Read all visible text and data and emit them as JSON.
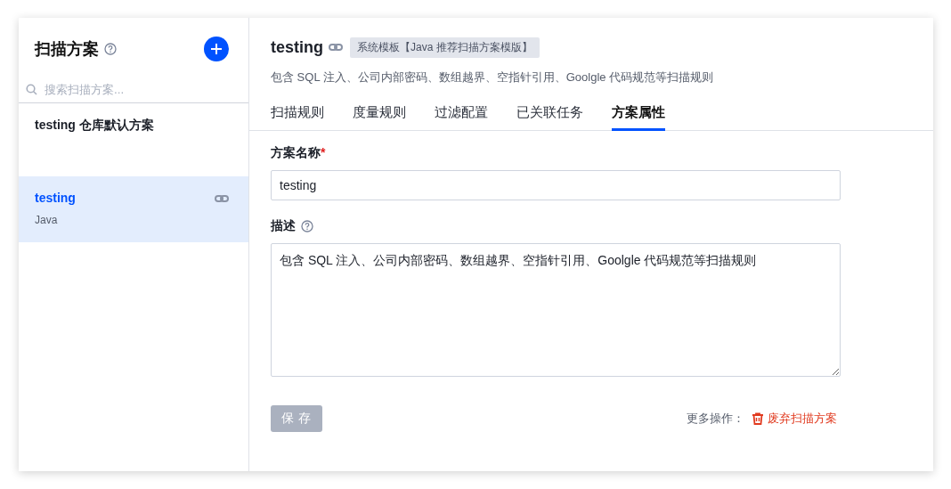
{
  "sidebar": {
    "title": "扫描方案",
    "search": {
      "placeholder": "搜索扫描方案..."
    },
    "items": [
      {
        "name": "testing 仓库默认方案",
        "selected": false,
        "linked": false
      },
      {
        "name": "testing",
        "subtitle": "Java",
        "selected": true,
        "linked": true
      }
    ]
  },
  "header": {
    "title": "testing",
    "tag": "系统模板【Java 推荐扫描方案模版】",
    "description": "包含 SQL 注入、公司内部密码、数组越界、空指针引用、Goolgle 代码规范等扫描规则"
  },
  "tabs": [
    {
      "label": "扫描规则",
      "selected": false
    },
    {
      "label": "度量规则",
      "selected": false
    },
    {
      "label": "过滤配置",
      "selected": false
    },
    {
      "label": "已关联任务",
      "selected": false
    },
    {
      "label": "方案属性",
      "selected": true
    }
  ],
  "form": {
    "name_label": "方案名称",
    "name_required": "*",
    "name_value": "testing",
    "desc_label": "描述",
    "desc_value": "包含 SQL 注入、公司内部密码、数组越界、空指针引用、Goolgle 代码规范等扫描规则"
  },
  "save_button": {
    "label": "保 存",
    "disabled": true
  },
  "more_actions": {
    "label": "更多操作：",
    "delete": "废弃扫描方案"
  }
}
